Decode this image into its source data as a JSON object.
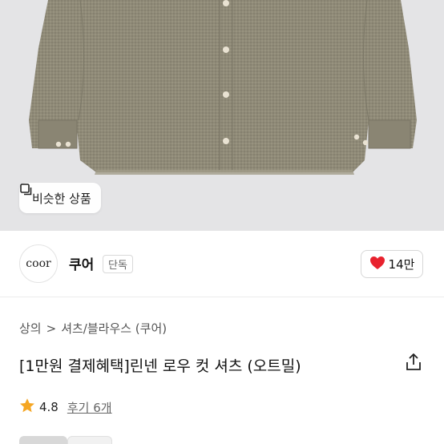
{
  "product_image": {
    "alt": "oatmeal linen shirt photo"
  },
  "similar_button": {
    "label": "비슷한 상품",
    "icon": "copy-square-icon"
  },
  "seller": {
    "logo_text": "coor",
    "name": "쿠어",
    "badge": "단독"
  },
  "like": {
    "count": "14만",
    "icon": "heart-icon",
    "color": "#e8222e"
  },
  "breadcrumb": {
    "root": "상의",
    "separator": ">",
    "current": "셔츠/블라우스 (쿠어)"
  },
  "product": {
    "title": "[1만원 결제혜택]린넨 로우 컷 셔츠 (오트밀)"
  },
  "rating": {
    "score": "4.8",
    "reviews": "후기 6개",
    "star_color": "#f5a623"
  },
  "colors": {
    "shirt": "#8f8a78",
    "backdrop": "#e4e4e6"
  }
}
